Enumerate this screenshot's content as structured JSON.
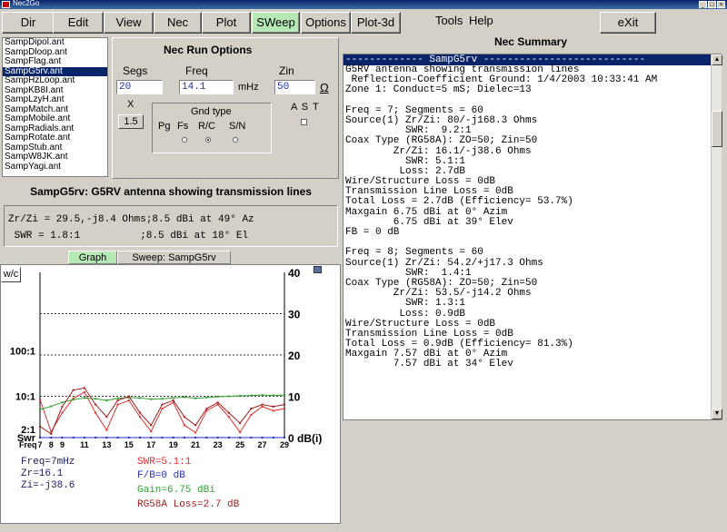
{
  "window": {
    "title": "Nec2Go"
  },
  "toolbar": [
    {
      "label": "Dir",
      "active": false
    },
    {
      "label": "Edit",
      "active": false
    },
    {
      "label": "View",
      "active": false
    },
    {
      "label": "Nec",
      "active": false
    },
    {
      "label": "Plot",
      "active": false
    },
    {
      "label": "SWeep",
      "active": true
    },
    {
      "label": "Options",
      "active": false
    },
    {
      "label": "Plot-3d",
      "active": false
    }
  ],
  "menu": {
    "tools": "Tools",
    "help": "Help"
  },
  "exit_label": "eXit",
  "files": [
    "SampDipol.ant",
    "SampDloop.ant",
    "SampFlag.ant",
    "SampG5rv.ant",
    "SampHzLoop.ant",
    "SampKB8I.ant",
    "SampLzyH.ant",
    "SampMatch.ant",
    "SampMobile.ant",
    "SampRadials.ant",
    "SampRotate.ant",
    "SampStub.ant",
    "SampW8JK.ant",
    "SampYagi.ant"
  ],
  "selected_file": 3,
  "run_options": {
    "title": "Nec Run Options",
    "segs_label": "Segs",
    "segs_value": "20",
    "freq_label": "Freq",
    "freq_value": "14.1",
    "freq_unit": "mHz",
    "zin_label": "Zin",
    "zin_value": "50",
    "zin_unit": "Ω",
    "x_label": "X",
    "x_value": "1.5",
    "gnd_title": "Gnd type",
    "gnd_options": [
      "Pg",
      "Fs",
      "R/C",
      "S/N"
    ],
    "gnd_selected": 2,
    "ast_label": "A S T"
  },
  "antenna_title": "SampG5rv: G5RV antenna showing transmission lines",
  "results": {
    "line1": "Zr/Zi = 29.5,-j8.4 Ohms;8.5 dBi at 49° Az",
    "line2": " SWR = 1.8:1          ;8.5 dBi at 18° El"
  },
  "tabs": {
    "graph": "Graph",
    "sweep": "Sweep: SampG5rv"
  },
  "graph": {
    "wc_label": "w/c",
    "left_ticks": [
      "100:1",
      "10:1",
      "2:1",
      "Swr"
    ],
    "right_ticks": [
      "40",
      "30",
      "20",
      "10",
      "0 dB(i)"
    ],
    "x_prefix": "Freq",
    "x_ticks": [
      "7",
      "8",
      "9",
      "11",
      "13",
      "15",
      "17",
      "19",
      "21",
      "23",
      "25",
      "27",
      "29"
    ]
  },
  "chart_data": {
    "type": "line",
    "x": [
      7,
      8,
      9,
      10,
      11,
      12,
      13,
      14,
      15,
      16,
      17,
      18,
      19,
      20,
      21,
      22,
      23,
      24,
      25,
      26,
      27,
      28,
      29
    ],
    "xlabel": "Freq",
    "ylabel": "dB(i)",
    "ylim": [
      0,
      40
    ],
    "series": [
      {
        "name": "SWR",
        "color": "#e03030",
        "values": [
          9.2,
          1.4,
          6,
          9.5,
          11,
          6,
          1.8,
          8,
          9,
          5,
          1.5,
          7,
          8.5,
          3,
          1.2,
          6.5,
          8,
          5,
          1.3,
          5.5,
          7.5,
          6.5,
          7
        ]
      },
      {
        "name": "F/B",
        "color": "#2030c0",
        "values": [
          0,
          0,
          0,
          0,
          0,
          0,
          0,
          0,
          0,
          0,
          0,
          0,
          0,
          0,
          0,
          0,
          0,
          0,
          0,
          0,
          0,
          0,
          0
        ]
      },
      {
        "name": "Gain",
        "color": "#30a030",
        "values": [
          6.75,
          7.57,
          8.5,
          9.2,
          9.6,
          9.4,
          9.0,
          9.5,
          9.7,
          9.6,
          9.3,
          9.4,
          9.6,
          9.8,
          9.5,
          9.7,
          9.9,
          10.0,
          10.1,
          10.2,
          10.3,
          10.2,
          10.3
        ]
      },
      {
        "name": "RG58A Loss",
        "color": "#a02020",
        "values": [
          2.7,
          0.9,
          7.5,
          11.5,
          12,
          8,
          5,
          9,
          10,
          6,
          3,
          8,
          9,
          5,
          3,
          7,
          8.5,
          6,
          3.5,
          7,
          8,
          7.5,
          8
        ]
      }
    ]
  },
  "readouts": {
    "freq": "Freq=7mHz",
    "zr": "Zr=16.1",
    "zi": "Zi=-j38.6",
    "swr": "SWR=5.1:1",
    "fb": "F/B=0 dB",
    "gain": "Gain=6.75 dBi",
    "loss": "RG58A Loss=2.7 dB"
  },
  "colors": {
    "swr": "#e03030",
    "fb": "#2030c0",
    "gain": "#30a030",
    "loss": "#a02020",
    "readout": "#1a1a60"
  },
  "summary": {
    "title": "Nec Summary",
    "header": "------------- SampG5rv ---------------------------",
    "lines": [
      "G5RV antenna showing transmission lines",
      " Reflection-Coefficient Ground: 1/4/2003 10:33:41 AM",
      "Zone 1: Conduct=5 mS; Dielec=13",
      "",
      "Freq = 7; Segments = 60",
      "Source(1) Zr/Zi: 80/-j168.3 Ohms",
      "          SWR:  9.2:1",
      "Coax Type (RG58A): ZO=50; Zin=50",
      "        Zr/Zi: 16.1/-j38.6 Ohms",
      "          SWR: 5.1:1",
      "         Loss: 2.7dB",
      "Wire/Structure Loss = 0dB",
      "Transmission Line Loss = 0dB",
      "Total Loss = 2.7dB (Efficiency= 53.7%)",
      "Maxgain 6.75 dBi at 0° Azim",
      "        6.75 dBi at 39° Elev",
      "FB = 0 dB",
      "",
      "Freq = 8; Segments = 60",
      "Source(1) Zr/Zi: 54.2/+j17.3 Ohms",
      "          SWR:  1.4:1",
      "Coax Type (RG58A): ZO=50; Zin=50",
      "        Zr/Zi: 53.5/-j14.2 Ohms",
      "          SWR: 1.3:1",
      "         Loss: 0.9dB",
      "Wire/Structure Loss = 0dB",
      "Transmission Line Loss = 0dB",
      "Total Loss = 0.9dB (Efficiency= 81.3%)",
      "Maxgain 7.57 dBi at 0° Azim",
      "        7.57 dBi at 34° Elev"
    ]
  }
}
